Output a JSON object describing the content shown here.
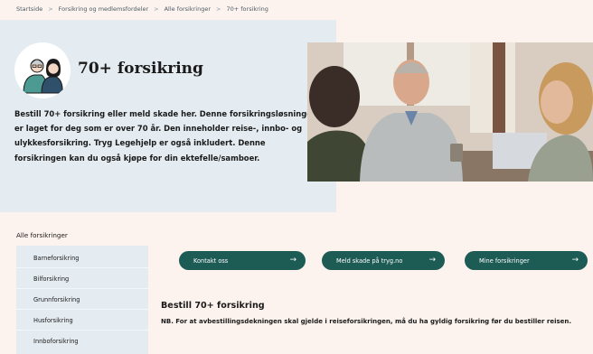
{
  "breadcrumb": {
    "items": [
      "Startside",
      "Forsikring og medlemsfordeler",
      "Alle forsikringer",
      "70+ forsikring"
    ],
    "separator": ">"
  },
  "hero": {
    "title": "70+ forsikring",
    "description": "Bestill 70+ forsikring eller meld skade her. Denne forsikringsløsningen er laget for deg som er over 70 år. Den inneholder reise-, innbo- og ulykkesforsikring. Tryg Legehjelp er også inkludert. Denne forsikringen kan du også kjøpe for din ektefelle/samboer.",
    "icon": "elderly-couple-icon"
  },
  "sidebar": {
    "heading": "Alle forsikringer",
    "items": [
      {
        "label": "Barneforsikring"
      },
      {
        "label": "Bilforsikring"
      },
      {
        "label": "Grunnforsikring"
      },
      {
        "label": "Husforsikring"
      },
      {
        "label": "Innboforsikring"
      }
    ]
  },
  "actions": {
    "buttons": [
      {
        "label": "Kontakt oss",
        "icon": "arrow-right-icon"
      },
      {
        "label": "Meld skade på tryg.no",
        "icon": "arrow-right-icon"
      },
      {
        "label": "Mine forsikringer",
        "icon": "arrow-right-icon"
      }
    ]
  },
  "content": {
    "title": "Bestill 70+ forsikring",
    "note": "NB. For at avbestillingsdekningen skal gjelde i reiseforsikringen, må du ha gyldig forsikring før du bestiller reisen."
  },
  "colors": {
    "page_background": "#fdf3ee",
    "panel_background": "#e5ecf1",
    "button": "#1d5b55"
  }
}
